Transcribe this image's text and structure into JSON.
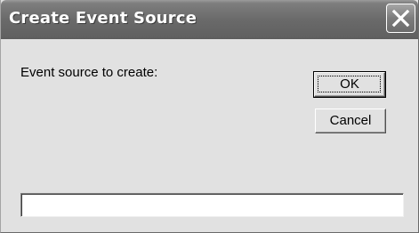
{
  "window": {
    "title": "Create Event Source",
    "close_icon": "close-icon"
  },
  "form": {
    "prompt_label": "Event source to create:",
    "source_value": "",
    "ok_label": "OK",
    "cancel_label": "Cancel"
  },
  "colors": {
    "titlebar": "#6a6a6a",
    "dialog_background": "#e1e1e1"
  }
}
